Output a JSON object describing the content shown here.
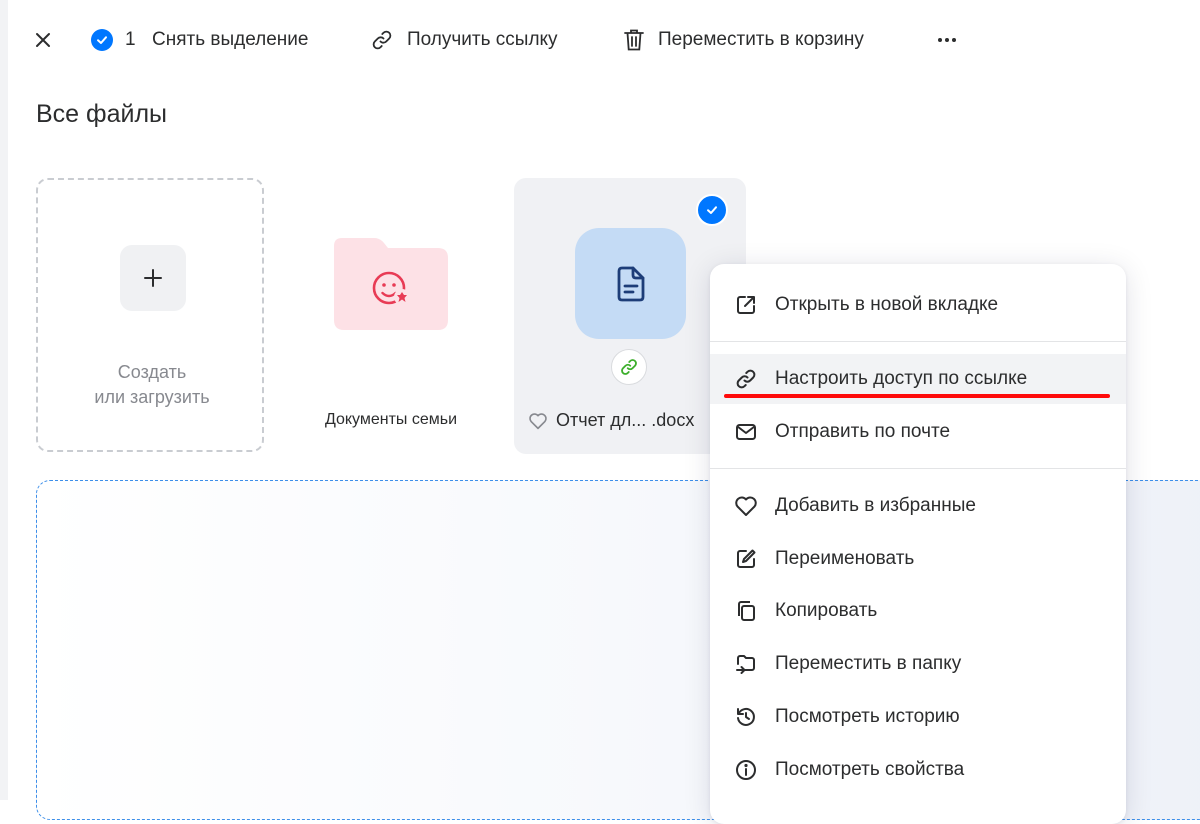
{
  "toolbar": {
    "selected_count": "1",
    "deselect_label": "Снять выделение",
    "get_link_label": "Получить ссылку",
    "trash_label": "Переместить в корзину"
  },
  "page": {
    "title": "Все файлы"
  },
  "tiles": {
    "create_label": "Создать\nили загрузить",
    "folder_label": "Документы семьи",
    "file_name": "Отчет дл... .docx"
  },
  "colors": {
    "accent": "#0077ff",
    "folder": "#fde1e6",
    "doc_bg": "#c4dbf5",
    "highlight_underline": "#ff0a0a"
  },
  "context_menu": {
    "items": [
      {
        "label": "Открыть в новой вкладке",
        "icon": "external-link-icon"
      },
      {
        "label": "Настроить доступ по ссылке",
        "icon": "link-icon"
      },
      {
        "label": "Отправить по почте",
        "icon": "mail-icon"
      },
      {
        "label": "Добавить в избранные",
        "icon": "heart-icon"
      },
      {
        "label": "Переименовать",
        "icon": "edit-icon"
      },
      {
        "label": "Копировать",
        "icon": "copy-icon"
      },
      {
        "label": "Переместить в папку",
        "icon": "move-to-folder-icon"
      },
      {
        "label": "Посмотреть историю",
        "icon": "history-icon"
      },
      {
        "label": "Посмотреть свойства",
        "icon": "info-icon"
      }
    ]
  }
}
